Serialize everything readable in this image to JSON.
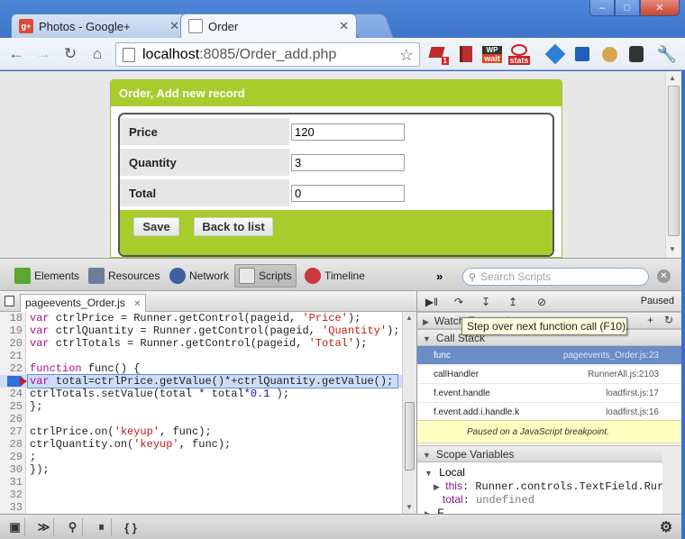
{
  "browser": {
    "tabs": [
      {
        "title": "Photos - Google+",
        "close": "✕"
      },
      {
        "title": "Order",
        "close": "✕"
      }
    ],
    "window_buttons": {
      "minimize": "–",
      "maximize": "□",
      "close": "✕"
    },
    "address": {
      "host": "localhost",
      "path": ":8085/Order_add.php"
    },
    "nav_icons": [
      "back-icon",
      "forward-icon",
      "reload-icon",
      "home-icon"
    ],
    "extensions": {
      "counter": "1",
      "wait_label": "wait",
      "wait_top": "WP",
      "stats_label": "stats"
    }
  },
  "form": {
    "title": "Order, Add new record",
    "fields": [
      {
        "label": "Price",
        "value": "120"
      },
      {
        "label": "Quantity",
        "value": "3"
      },
      {
        "label": "Total",
        "value": "0"
      }
    ],
    "save_label": "Save",
    "back_label": "Back to list"
  },
  "devtools": {
    "tabs": [
      "Elements",
      "Resources",
      "Network",
      "Scripts",
      "Timeline"
    ],
    "more": "»",
    "search_placeholder": "Search Scripts",
    "file_tab": "pageevents_Order.js",
    "status": "Paused",
    "tooltip": "Step over next function call (F10).",
    "sections": {
      "watch": "Watch Expressions",
      "callstack": "Call Stack",
      "scope": "Scope Variables"
    },
    "call_stack": [
      {
        "fn": "func",
        "loc": "pageevents_Order.js:23"
      },
      {
        "fn": "callHandler",
        "loc": "RunnerAll.js:2103"
      },
      {
        "fn": "f.event.handle",
        "loc": "loadfirst.js:17"
      },
      {
        "fn": "f.event.add.i.handle.k",
        "loc": "loadfirst.js:16"
      }
    ],
    "breakpoint_message": "Paused on a JavaScript breakpoint.",
    "scope": {
      "local_label": "Local",
      "this_name": "this",
      "this_value": "Runner.controls.TextField.Rur",
      "total_name": "total",
      "total_value": "undefined",
      "truncated_row": "F"
    },
    "code_lines": [
      {
        "n": "18",
        "t": "var ctrlPrice = Runner.getControl(pageid, 'Price');"
      },
      {
        "n": "19",
        "t": "var ctrlQuantity = Runner.getControl(pageid, 'Quantity');"
      },
      {
        "n": "20",
        "t": "var ctrlTotals = Runner.getControl(pageid, 'Total');"
      },
      {
        "n": "21",
        "t": ""
      },
      {
        "n": "22",
        "t": "function func() {"
      },
      {
        "n": "23",
        "t": "var total=ctrlPrice.getValue()*+ctrlQuantity.getValue();"
      },
      {
        "n": "24",
        "t": "ctrlTotals.setValue(total * total*0.1 );"
      },
      {
        "n": "25",
        "t": "};"
      },
      {
        "n": "26",
        "t": ""
      },
      {
        "n": "27",
        "t": "ctrlPrice.on('keyup', func);"
      },
      {
        "n": "28",
        "t": "ctrlQuantity.on('keyup', func);"
      },
      {
        "n": "29",
        "t": ";"
      },
      {
        "n": "30",
        "t": "});"
      },
      {
        "n": "31",
        "t": ""
      },
      {
        "n": "32",
        "t": ""
      },
      {
        "n": "33",
        "t": ""
      }
    ],
    "current_line": "23"
  },
  "colors": {
    "form_green": "#a8cc2c",
    "selected_frame": "#6b8cc7",
    "chrome_blue": "#3d74c9"
  }
}
